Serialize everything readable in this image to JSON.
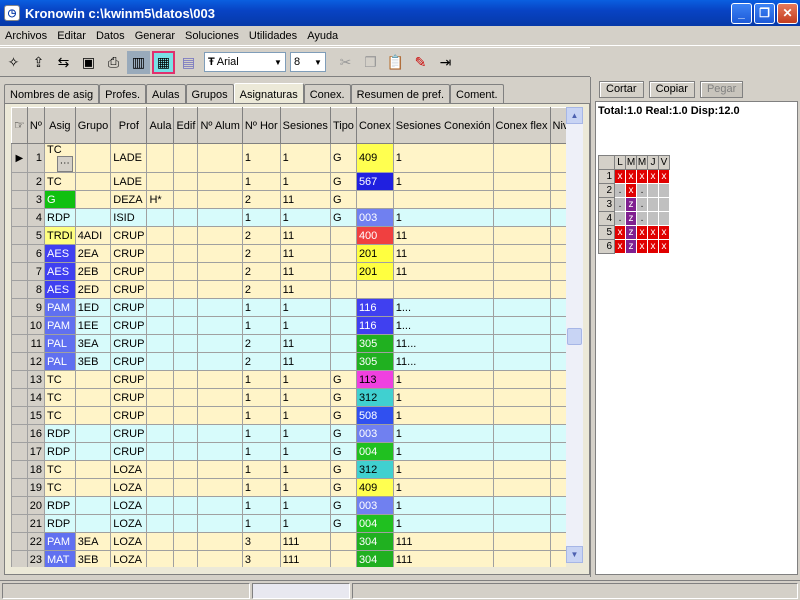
{
  "window": {
    "title": "Kronowin  c:\\kwinm5\\datos\\003"
  },
  "menu": [
    "Archivos",
    "Editar",
    "Datos",
    "Generar",
    "Soluciones",
    "Utilidades",
    "Ayuda"
  ],
  "toolbar": {
    "font": "Arial",
    "size": "8"
  },
  "right_panel": {
    "cut": "Cortar",
    "copy": "Copiar",
    "paste": "Pegar",
    "totals": "Total:1.0 Real:1.0 Disp:12.0"
  },
  "schedule": {
    "days": [
      "L",
      "M",
      "M",
      "J",
      "V"
    ],
    "rows": [
      {
        "n": "1",
        "cells": [
          {
            "t": "x",
            "c": "red"
          },
          {
            "t": "x",
            "c": "red"
          },
          {
            "t": "x",
            "c": "red"
          },
          {
            "t": "x",
            "c": "red"
          },
          {
            "t": "x",
            "c": "red"
          }
        ]
      },
      {
        "n": "2",
        "cells": [
          {
            "t": ".",
            "c": "gray"
          },
          {
            "t": "x",
            "c": "red"
          },
          {
            "t": ".",
            "c": "gray"
          },
          {
            "t": "",
            "c": "gray"
          },
          {
            "t": "",
            "c": "gray"
          }
        ]
      },
      {
        "n": "3",
        "cells": [
          {
            "t": ".",
            "c": "gray"
          },
          {
            "t": "z",
            "c": "purple"
          },
          {
            "t": ".",
            "c": "gray"
          },
          {
            "t": "",
            "c": "gray"
          },
          {
            "t": "",
            "c": "gray"
          }
        ]
      },
      {
        "n": "4",
        "cells": [
          {
            "t": ".",
            "c": "gray"
          },
          {
            "t": "z",
            "c": "purple"
          },
          {
            "t": ".",
            "c": "gray"
          },
          {
            "t": "",
            "c": "gray"
          },
          {
            "t": "",
            "c": "gray"
          }
        ]
      },
      {
        "n": "5",
        "cells": [
          {
            "t": "x",
            "c": "red"
          },
          {
            "t": "z",
            "c": "purple"
          },
          {
            "t": "x",
            "c": "red"
          },
          {
            "t": "x",
            "c": "red"
          },
          {
            "t": "x",
            "c": "red"
          }
        ]
      },
      {
        "n": "6",
        "cells": [
          {
            "t": "x",
            "c": "red"
          },
          {
            "t": "z",
            "c": "purple"
          },
          {
            "t": "x",
            "c": "red"
          },
          {
            "t": "x",
            "c": "red"
          },
          {
            "t": "x",
            "c": "red"
          }
        ]
      }
    ]
  },
  "tabs": [
    "Nombres de asig",
    "Profes.",
    "Aulas",
    "Grupos",
    "Asignaturas",
    "Conex.",
    "Resumen de pref.",
    "Coment."
  ],
  "active_tab": 4,
  "columns": [
    "Nº",
    "Asig",
    "Grupo",
    "Prof",
    "Aula",
    "Edif",
    "Nº Alum",
    "Nº Hor",
    "Sesiones",
    "Tipo",
    "Conex",
    "Sesiones Conexión",
    "Conex flex",
    "Nivel Conflex"
  ],
  "rows": [
    {
      "n": "1",
      "asig": "TC",
      "asig_color": "#fff4c8",
      "grupo": "",
      "prof": "LADE",
      "aula": "",
      "hor": "1",
      "ses": "1",
      "tipo": "G",
      "conex": "409",
      "conex_color": "#ffff50",
      "sesc": "1",
      "bg": "yel",
      "current": true
    },
    {
      "n": "2",
      "asig": "TC",
      "asig_color": "#fff4c8",
      "grupo": "",
      "prof": "LADE",
      "aula": "",
      "hor": "1",
      "ses": "1",
      "tipo": "G",
      "conex": "567",
      "conex_color": "#2020e0",
      "sesc": "1",
      "bg": "yel"
    },
    {
      "n": "3",
      "asig": "G",
      "asig_color": "#10c010",
      "grupo": "",
      "prof": "DEZA",
      "aula": "H*",
      "hor": "2",
      "ses": "11",
      "tipo": "G",
      "conex": "",
      "conex_color": "",
      "sesc": "",
      "bg": "yel"
    },
    {
      "n": "4",
      "asig": "RDP",
      "asig_color": "#d7fbfb",
      "grupo": "",
      "prof": "ISID",
      "aula": "",
      "hor": "1",
      "ses": "1",
      "tipo": "G",
      "conex": "003",
      "conex_color": "#7080f0",
      "sesc": "1",
      "bg": "cyan"
    },
    {
      "n": "5",
      "asig": "TRDI",
      "asig_color": "#ffff80",
      "grupo": "4ADI",
      "prof": "CRUP",
      "aula": "",
      "hor": "2",
      "ses": "11",
      "tipo": "",
      "conex": "400",
      "conex_color": "#f04040",
      "sesc": "11",
      "bg": "yel"
    },
    {
      "n": "6",
      "asig": "AES",
      "asig_color": "#4040f0",
      "grupo": "2EA",
      "prof": "CRUP",
      "aula": "",
      "hor": "2",
      "ses": "11",
      "tipo": "",
      "conex": "201",
      "conex_color": "#ffff40",
      "sesc": "11",
      "bg": "yel"
    },
    {
      "n": "7",
      "asig": "AES",
      "asig_color": "#4040f0",
      "grupo": "2EB",
      "prof": "CRUP",
      "aula": "",
      "hor": "2",
      "ses": "11",
      "tipo": "",
      "conex": "201",
      "conex_color": "#ffff40",
      "sesc": "11",
      "bg": "yel"
    },
    {
      "n": "8",
      "asig": "AES",
      "asig_color": "#4040f0",
      "grupo": "2ED",
      "prof": "CRUP",
      "aula": "",
      "hor": "2",
      "ses": "11",
      "tipo": "",
      "conex": "",
      "conex_color": "",
      "sesc": "",
      "bg": "yel"
    },
    {
      "n": "9",
      "asig": "PAM",
      "asig_color": "#6070f0",
      "grupo": "1ED",
      "prof": "CRUP",
      "aula": "",
      "hor": "1",
      "ses": "1",
      "tipo": "",
      "conex": "116",
      "conex_color": "#4040f0",
      "sesc": "1...",
      "bg": "cyan"
    },
    {
      "n": "10",
      "asig": "PAM",
      "asig_color": "#6070f0",
      "grupo": "1EE",
      "prof": "CRUP",
      "aula": "",
      "hor": "1",
      "ses": "1",
      "tipo": "",
      "conex": "116",
      "conex_color": "#4040f0",
      "sesc": "1...",
      "bg": "cyan"
    },
    {
      "n": "11",
      "asig": "PAL",
      "asig_color": "#6070f0",
      "grupo": "3EA",
      "prof": "CRUP",
      "aula": "",
      "hor": "2",
      "ses": "11",
      "tipo": "",
      "conex": "305",
      "conex_color": "#20b020",
      "sesc": "11...",
      "bg": "cyan"
    },
    {
      "n": "12",
      "asig": "PAL",
      "asig_color": "#6070f0",
      "grupo": "3EB",
      "prof": "CRUP",
      "aula": "",
      "hor": "2",
      "ses": "11",
      "tipo": "",
      "conex": "305",
      "conex_color": "#20b020",
      "sesc": "11...",
      "bg": "cyan"
    },
    {
      "n": "13",
      "asig": "TC",
      "asig_color": "#fff4c8",
      "grupo": "",
      "prof": "CRUP",
      "aula": "",
      "hor": "1",
      "ses": "1",
      "tipo": "G",
      "conex": "113",
      "conex_color": "#f040e0",
      "sesc": "1",
      "bg": "yel"
    },
    {
      "n": "14",
      "asig": "TC",
      "asig_color": "#fff4c8",
      "grupo": "",
      "prof": "CRUP",
      "aula": "",
      "hor": "1",
      "ses": "1",
      "tipo": "G",
      "conex": "312",
      "conex_color": "#40d0d0",
      "sesc": "1",
      "bg": "yel"
    },
    {
      "n": "15",
      "asig": "TC",
      "asig_color": "#fff4c8",
      "grupo": "",
      "prof": "CRUP",
      "aula": "",
      "hor": "1",
      "ses": "1",
      "tipo": "G",
      "conex": "508",
      "conex_color": "#3050f0",
      "sesc": "1",
      "bg": "yel"
    },
    {
      "n": "16",
      "asig": "RDP",
      "asig_color": "#d7fbfb",
      "grupo": "",
      "prof": "CRUP",
      "aula": "",
      "hor": "1",
      "ses": "1",
      "tipo": "G",
      "conex": "003",
      "conex_color": "#7080f0",
      "sesc": "1",
      "bg": "cyan"
    },
    {
      "n": "17",
      "asig": "RDP",
      "asig_color": "#d7fbfb",
      "grupo": "",
      "prof": "CRUP",
      "aula": "",
      "hor": "1",
      "ses": "1",
      "tipo": "G",
      "conex": "004",
      "conex_color": "#20c020",
      "sesc": "1",
      "bg": "cyan"
    },
    {
      "n": "18",
      "asig": "TC",
      "asig_color": "#fff4c8",
      "grupo": "",
      "prof": "LOZA",
      "aula": "",
      "hor": "1",
      "ses": "1",
      "tipo": "G",
      "conex": "312",
      "conex_color": "#40d0d0",
      "sesc": "1",
      "bg": "yel"
    },
    {
      "n": "19",
      "asig": "TC",
      "asig_color": "#fff4c8",
      "grupo": "",
      "prof": "LOZA",
      "aula": "",
      "hor": "1",
      "ses": "1",
      "tipo": "G",
      "conex": "409",
      "conex_color": "#ffff50",
      "sesc": "1",
      "bg": "yel"
    },
    {
      "n": "20",
      "asig": "RDP",
      "asig_color": "#d7fbfb",
      "grupo": "",
      "prof": "LOZA",
      "aula": "",
      "hor": "1",
      "ses": "1",
      "tipo": "G",
      "conex": "003",
      "conex_color": "#7080f0",
      "sesc": "1",
      "bg": "cyan"
    },
    {
      "n": "21",
      "asig": "RDP",
      "asig_color": "#d7fbfb",
      "grupo": "",
      "prof": "LOZA",
      "aula": "",
      "hor": "1",
      "ses": "1",
      "tipo": "G",
      "conex": "004",
      "conex_color": "#20c020",
      "sesc": "1",
      "bg": "cyan"
    },
    {
      "n": "22",
      "asig": "PAM",
      "asig_color": "#6070f0",
      "grupo": "3EA",
      "prof": "LOZA",
      "aula": "",
      "hor": "3",
      "ses": "111",
      "tipo": "",
      "conex": "304",
      "conex_color": "#20b020",
      "sesc": "111",
      "bg": "yel"
    },
    {
      "n": "23",
      "asig": "MAT",
      "asig_color": "#6070f0",
      "grupo": "3EB",
      "prof": "LOZA",
      "aula": "",
      "hor": "3",
      "ses": "111",
      "tipo": "",
      "conex": "304",
      "conex_color": "#20b020",
      "sesc": "111",
      "bg": "yel"
    }
  ]
}
